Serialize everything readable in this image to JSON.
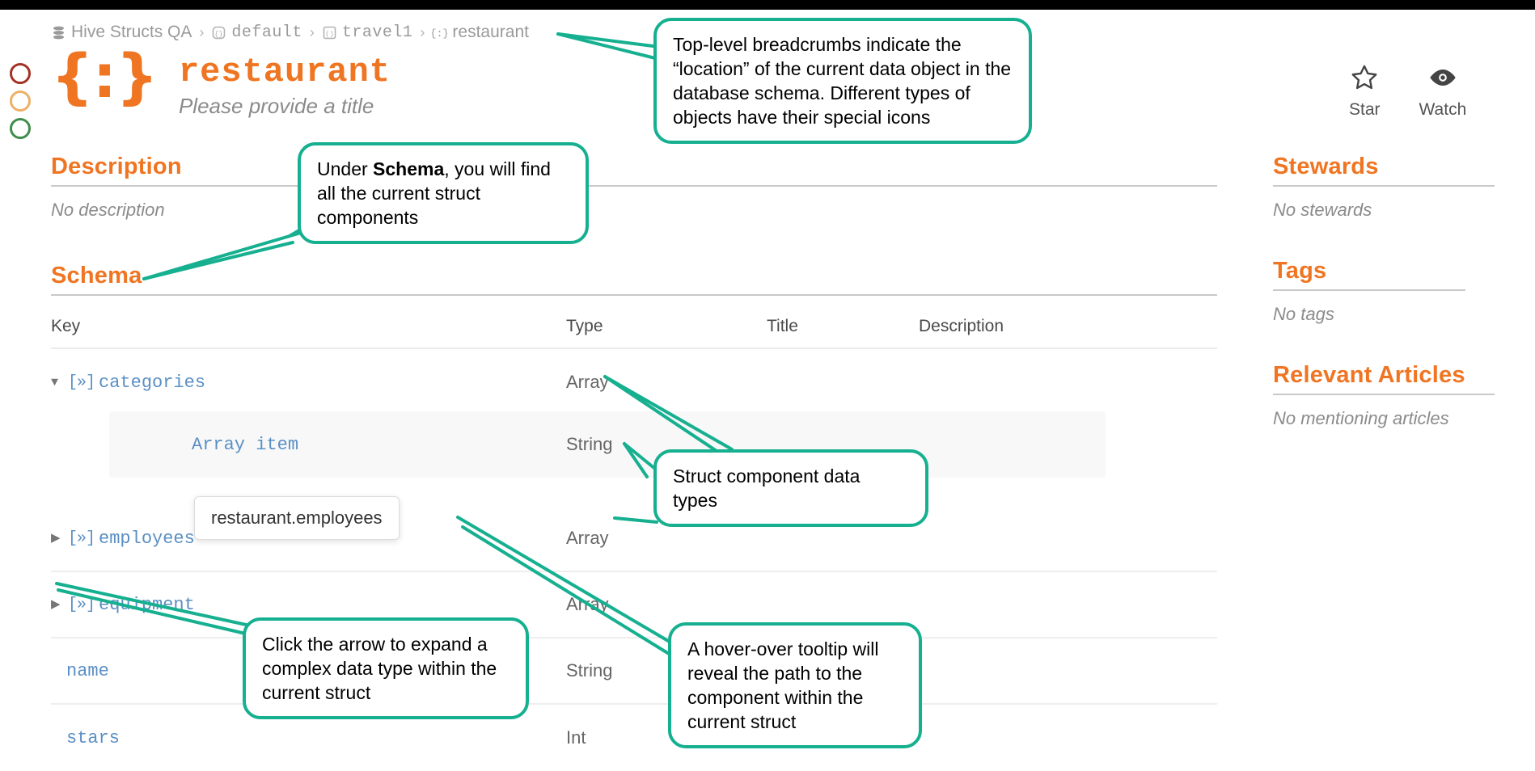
{
  "window": {
    "titlebar_color": "#000000"
  },
  "traffic_dots": [
    {
      "name": "close",
      "color": "#a33226"
    },
    {
      "name": "minimize",
      "color": "#edb068"
    },
    {
      "name": "maximize",
      "color": "#3f8d4b"
    }
  ],
  "breadcrumb": [
    {
      "label": "Hive Structs QA",
      "icon": "database-icon",
      "mono": false
    },
    {
      "label": "default",
      "icon": "namespace-icon",
      "mono": true
    },
    {
      "label": "travel1",
      "icon": "table-icon",
      "mono": true
    },
    {
      "label": "restaurant",
      "icon": "struct-icon",
      "mono": false
    }
  ],
  "breadcrumb_separator": "›",
  "header": {
    "glyph": "{:}",
    "title": "restaurant",
    "subtitle": "Please provide a title",
    "accent_color": "#f07522"
  },
  "actions": [
    {
      "label": "Star",
      "icon": "star-icon"
    },
    {
      "label": "Watch",
      "icon": "eye-icon"
    }
  ],
  "description": {
    "heading": "Description",
    "empty_text": "No description"
  },
  "schema": {
    "heading": "Schema",
    "columns": [
      "Key",
      "Type",
      "Title",
      "Description"
    ],
    "rows": [
      {
        "key": "categories",
        "type": "Array",
        "title": "",
        "description": "",
        "expanded": true,
        "icon": "array-icon",
        "arrow": "expanded"
      },
      {
        "key": "employees",
        "type": "Array",
        "title": "",
        "description": "",
        "expanded": false,
        "icon": "array-icon",
        "arrow": "collapsed"
      },
      {
        "key": "equipment",
        "type": "Array",
        "title": "",
        "description": "",
        "expanded": false,
        "icon": "array-icon",
        "arrow": "collapsed"
      },
      {
        "key": "name",
        "type": "String",
        "title": "",
        "description": "",
        "expanded": false,
        "icon": "none",
        "arrow": "none"
      },
      {
        "key": "stars",
        "type": "Int",
        "title": "",
        "description": "",
        "expanded": false,
        "icon": "none",
        "arrow": "none"
      }
    ],
    "nested_row": {
      "key": "Array item",
      "type": "String",
      "title": "",
      "description": ""
    }
  },
  "tooltip": {
    "text": "restaurant.employees"
  },
  "rail": [
    {
      "heading": "Stewards",
      "empty_text": "No stewards"
    },
    {
      "heading": "Tags",
      "empty_text": "No tags"
    },
    {
      "heading": "Relevant Articles",
      "empty_text": "No mentioning articles"
    }
  ],
  "callouts": {
    "breadcrumbs": "Top-level breadcrumbs indicate the “location” of the current data object in the database schema. Different types of objects have their special icons",
    "schema_pre": "Under ",
    "schema_bold": "Schema",
    "schema_post": ", you will find all the current struct components",
    "types": "Struct component data types",
    "expand": "Click the arrow to expand a complex data type within the current struct",
    "hover": "A hover-over tooltip will reveal the path to the component within the current struct"
  },
  "colors": {
    "callout_border": "#16b090",
    "accent": "#f07522",
    "key_blue": "#5a8fc4"
  }
}
